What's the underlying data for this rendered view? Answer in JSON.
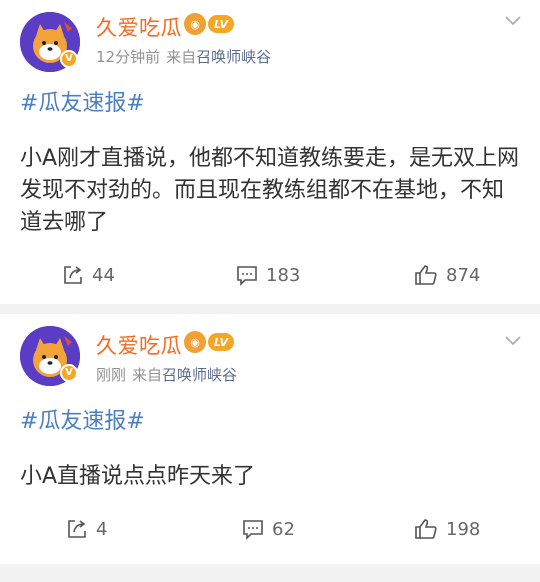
{
  "posts": [
    {
      "username": "久爱吃瓜",
      "lv_badge": "LV",
      "time": "12分钟前",
      "source_prefix": "来自",
      "source_name": "召唤师峡谷",
      "topic": "#瓜友速报#",
      "body": "小A刚才直播说，他都不知道教练要走，是无双上网发现不对劲的。而且现在教练组都不在基地，不知道去哪了",
      "reposts": "44",
      "comments": "183",
      "likes": "874"
    },
    {
      "username": "久爱吃瓜",
      "lv_badge": "LV",
      "time": "刚刚",
      "source_prefix": "来自",
      "source_name": "召唤师峡谷",
      "topic": "#瓜友速报#",
      "body": "小A直播说点点昨天来了",
      "reposts": "4",
      "comments": "62",
      "likes": "198"
    }
  ],
  "colors": {
    "username": "#f86a1e",
    "topic": "#4c7fc2",
    "meta": "#939393",
    "action": "#666666",
    "avatar_bg": "#5b3cc4",
    "badge": "#f5a623"
  },
  "icons": {
    "repost": "repost-icon",
    "comment": "comment-icon",
    "like": "like-icon",
    "more": "chevron-down-icon",
    "verified": "verified-icon"
  }
}
